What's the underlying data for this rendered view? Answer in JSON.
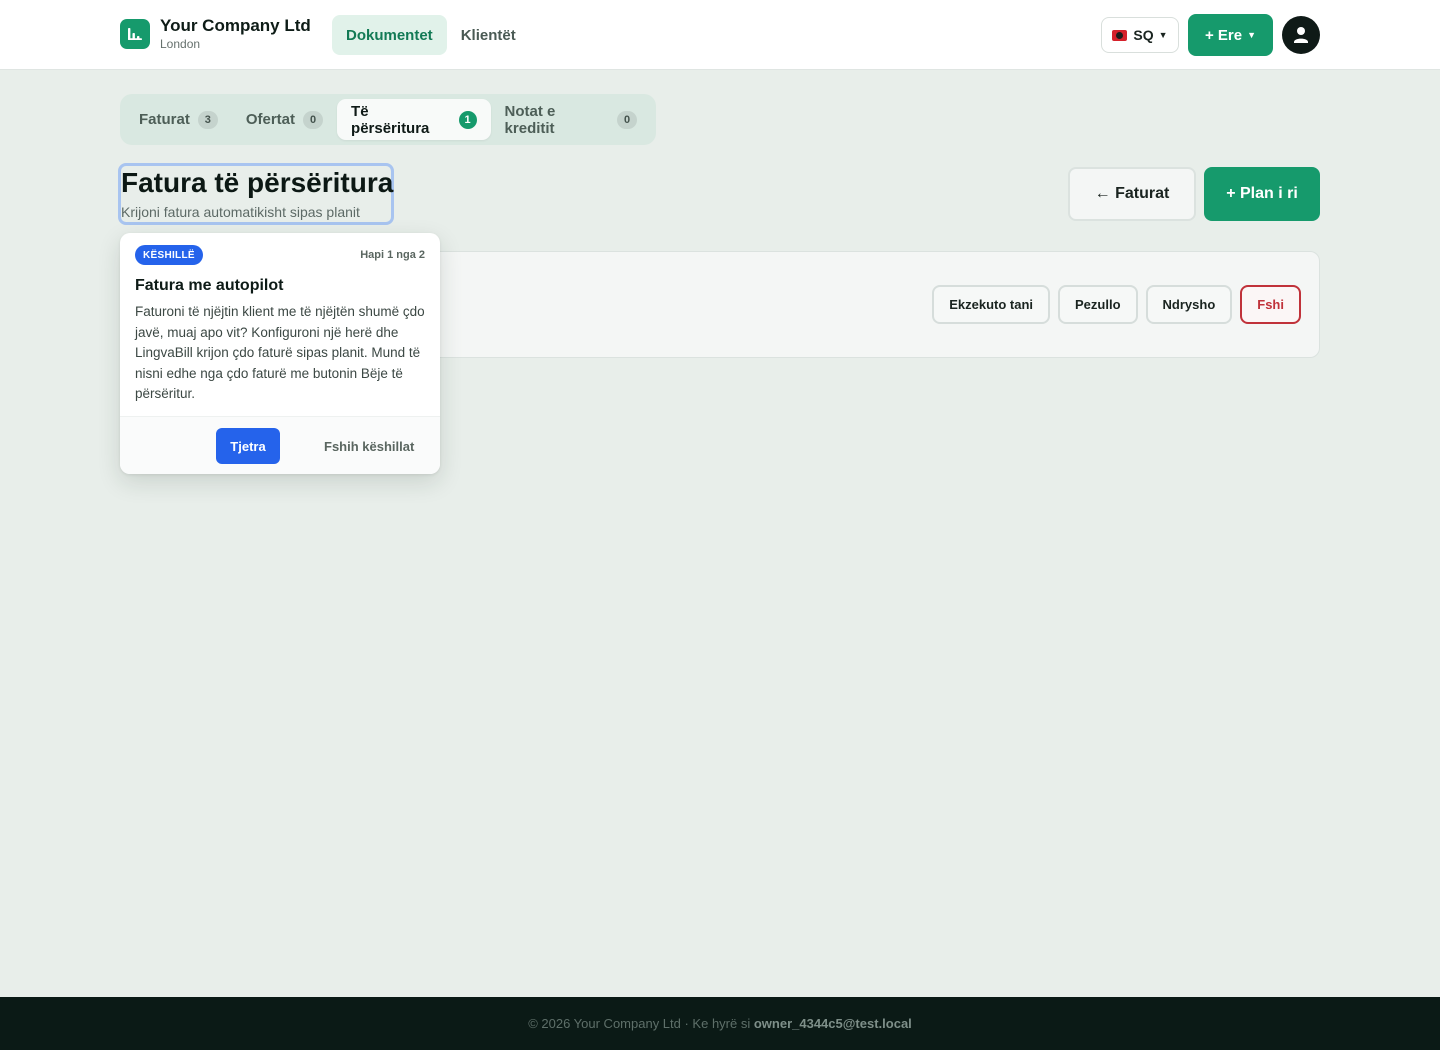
{
  "brand": {
    "name": "Your Company Ltd",
    "city": "London",
    "accent": "#169a6c"
  },
  "nav": [
    {
      "label": "Dokumentet",
      "active": true
    },
    {
      "label": "Klientët",
      "active": false
    }
  ],
  "header": {
    "lang": "SQ",
    "new_label": "+ Ere"
  },
  "tabs": [
    {
      "label": "Faturat",
      "count": "3",
      "active": false
    },
    {
      "label": "Ofertat",
      "count": "0",
      "active": false
    },
    {
      "label": "Të përsëritura",
      "count": "1",
      "active": true
    },
    {
      "label": "Notat e kreditit",
      "count": "0",
      "active": false
    }
  ],
  "page": {
    "title": "Fatura të përsëritura",
    "subtitle": "Krijoni fatura automatikisht sipas planit",
    "back_label": "← Faturat",
    "new_plan_label": "+ Plan i ri"
  },
  "card": {
    "actions": {
      "run": "Ekzekuto tani",
      "pause": "Pezullo",
      "edit": "Ndrysho",
      "delete": "Fshi"
    }
  },
  "tip": {
    "badge": "KËSHILLË",
    "step": "Hapi 1 nga 2",
    "title": "Fatura me autopilot",
    "body": "Faturoni të njëjtin klient me të njëjtën shumë çdo javë, muaj apo vit? Konfiguroni një herë dhe LingvaBill krijon çdo faturë sipas planit. Mund të nisni edhe nga çdo faturë me butonin Bëje të përsëritur.",
    "next": "Tjetra",
    "dismiss": "Fshih këshillat",
    "accent": "#2563eb"
  },
  "footer": {
    "prefix": "© 2026 Your Company Ltd · Ke hyrë si",
    "email": "owner_4344c5@test.local"
  }
}
